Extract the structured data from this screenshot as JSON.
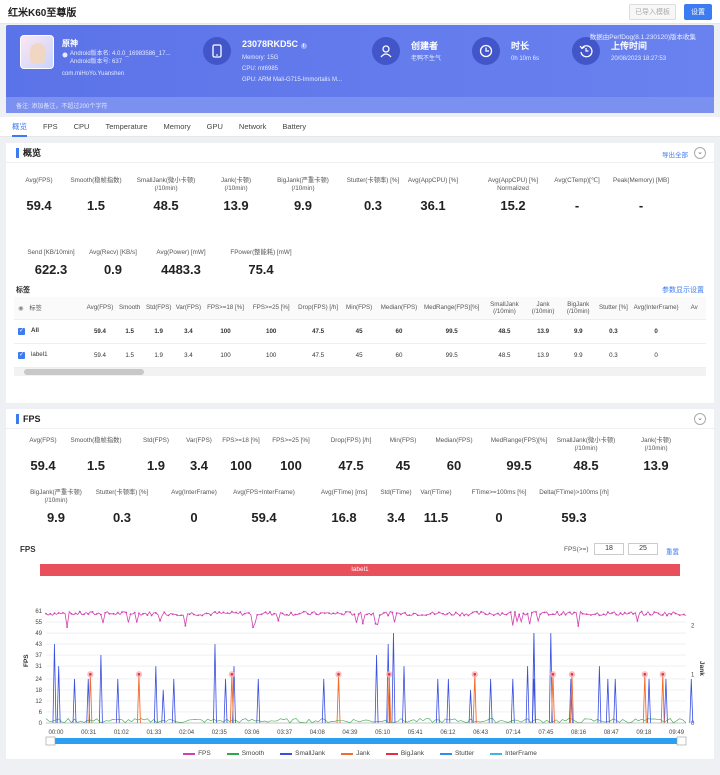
{
  "header": {
    "title": "红米K60至尊版",
    "btn_secondary": "已导入模板",
    "btn_settings": "设置"
  },
  "banner": {
    "app_name": "原神",
    "android_ver": "Android版本名: 4.0.0_16983586_17...",
    "android_code": "Android版本号: 637",
    "package": "com.miHoYo.Yuanshen",
    "device": "23078RKD5C",
    "memory": "Memory: 15G",
    "cpu": "CPU: mt6985",
    "gpu": "GPU: ARM Mali-G715-Immortalis M...",
    "creator_label": "创建者",
    "creator": "老鸭不生气",
    "duration_label": "时长",
    "duration": "0h 10m 6s",
    "upload_label": "上传时间",
    "upload": "20/08/2023 18:27:53",
    "notice": "数据由PerfDog(8.1.230120)版本收集",
    "note": "备注: 添加备注，不超过200个字符"
  },
  "tabs": [
    "概览",
    "FPS",
    "CPU",
    "Temperature",
    "Memory",
    "GPU",
    "Network",
    "Battery"
  ],
  "overview": {
    "title": "概览",
    "export": "导出全部",
    "metrics_row1": [
      {
        "label": "Avg(FPS)",
        "value": "59.4"
      },
      {
        "label": "Smooth(稳帧指数)",
        "value": "1.5"
      },
      {
        "label": "SmallJank(微小卡顿)\n(/10min)",
        "value": "48.5"
      },
      {
        "label": "Jank(卡顿)\n(/10min)",
        "value": "13.9"
      },
      {
        "label": "BigJank(严重卡顿)\n(/10min)",
        "value": "9.9"
      },
      {
        "label": "Stutter(卡顿率) [%]",
        "value": "0.3"
      },
      {
        "label": "Avg(AppCPU) [%]",
        "value": "36.1"
      },
      {
        "label": "Avg(AppCPU) [%]\nNormalized",
        "value": "15.2"
      },
      {
        "label": "Avg(CTemp)[℃]",
        "value": "-"
      },
      {
        "label": "Peak(Memory) [MB]",
        "value": "-"
      }
    ],
    "metrics_row2": [
      {
        "label": "Send [KB/10min]",
        "value": "622.3"
      },
      {
        "label": "Avg(Recv) [KB/s]",
        "value": "0.9"
      },
      {
        "label": "Avg(Power) [mW]",
        "value": "4483.3"
      },
      {
        "label": "FPower(整能耗) [mW]",
        "value": "75.4"
      }
    ],
    "tags_title": "标签",
    "tags_link": "参数显示设置",
    "table_headers": [
      "标签",
      "Avg(FPS)",
      "Smooth",
      "Std(FPS)",
      "Var(FPS)",
      "FPS>=18 [%]",
      "FPS>=25 [%]",
      "Drop(FPS) [/h]",
      "Min(FPS)",
      "Median(FPS)",
      "MedRange(FPS)[%]",
      "SmallJank\n(/10min)",
      "Jank\n(/10min)",
      "BigJank\n(/10min)",
      "Stutter [%]",
      "Avg(InterFrame)",
      "Av"
    ],
    "table_rows": [
      [
        "All",
        "59.4",
        "1.5",
        "1.9",
        "3.4",
        "100",
        "100",
        "47.5",
        "45",
        "60",
        "99.5",
        "48.5",
        "13.9",
        "9.9",
        "0.3",
        "0",
        ""
      ],
      [
        "label1",
        "59.4",
        "1.5",
        "1.9",
        "3.4",
        "100",
        "100",
        "47.5",
        "45",
        "60",
        "99.5",
        "48.5",
        "13.9",
        "9.9",
        "0.3",
        "0",
        ""
      ]
    ]
  },
  "fps_panel": {
    "title": "FPS",
    "metrics_row1": [
      {
        "label": "Avg(FPS)",
        "value": "59.4"
      },
      {
        "label": "Smooth(稳帧指数)",
        "value": "1.5"
      },
      {
        "label": "Std(FPS)",
        "value": "1.9"
      },
      {
        "label": "Var(FPS)",
        "value": "3.4"
      },
      {
        "label": "FPS>=18 [%]",
        "value": "100"
      },
      {
        "label": "FPS>=25 [%]",
        "value": "100"
      },
      {
        "label": "Drop(FPS) [/h]",
        "value": "47.5"
      },
      {
        "label": "Min(FPS)",
        "value": "45"
      },
      {
        "label": "Median(FPS)",
        "value": "60"
      },
      {
        "label": "MedRange(FPS)[%]",
        "value": "99.5"
      },
      {
        "label": "SmallJank(微小卡顿)\n(/10min)",
        "value": "48.5"
      },
      {
        "label": "Jank(卡顿)\n(/10min)",
        "value": "13.9"
      }
    ],
    "metrics_row2": [
      {
        "label": "BigJank(严重卡顿)\n(/10min)",
        "value": "9.9"
      },
      {
        "label": "Stutter(卡顿率) [%]",
        "value": "0.3"
      },
      {
        "label": "Avg(InterFrame)",
        "value": "0"
      },
      {
        "label": "Avg(FPS+InterFrame)",
        "value": "59.4"
      },
      {
        "label": "Avg(FTime) [ms]",
        "value": "16.8"
      },
      {
        "label": "Std(FTime)",
        "value": "3.4"
      },
      {
        "label": "Var(FTime)",
        "value": "11.5"
      },
      {
        "label": "FTime>=100ms [%]",
        "value": "0"
      },
      {
        "label": "Delta(FTime)>100ms [/h]",
        "value": "59.3"
      }
    ],
    "chart_label": "FPS",
    "threshold_label": "FPS(>=)",
    "threshold1": "18",
    "threshold2": "25",
    "reset": "重置",
    "label_bar": "label1"
  },
  "chart_data": {
    "type": "line",
    "title": "",
    "ylabel": "FPS",
    "y2label": "Jank",
    "yticks": [
      0,
      6,
      12,
      18,
      24,
      31,
      37,
      43,
      49,
      55,
      61
    ],
    "y2ticks": [
      0,
      1,
      2
    ],
    "ylim": [
      0,
      61
    ],
    "y2lim": [
      0,
      2.3
    ],
    "xticks": [
      "00:00",
      "00:31",
      "01:02",
      "01:33",
      "02:04",
      "02:35",
      "03:06",
      "03:37",
      "04:08",
      "04:39",
      "05:10",
      "05:41",
      "06:12",
      "06:43",
      "07:14",
      "07:45",
      "08:16",
      "08:47",
      "09:18",
      "09:49"
    ],
    "series": [
      {
        "name": "FPS",
        "color": "#d43fb0",
        "approx_value": 59.4
      },
      {
        "name": "Smooth",
        "color": "#2ea84a"
      },
      {
        "name": "SmallJank",
        "color": "#3a4fe0",
        "spike_times_s": [
          8,
          12,
          27,
          40,
          52,
          68,
          104,
          111,
          121,
          160,
          170,
          178,
          201,
          263,
          313,
          324,
          329,
          339,
          371,
          381,
          402,
          421,
          442,
          456,
          462,
          478,
          497,
          524,
          532,
          539,
          571,
          587,
          611
        ]
      },
      {
        "name": "Jank",
        "color": "#f26d2c",
        "spike_times_s": [
          42,
          88,
          176,
          277,
          325,
          406,
          480,
          498,
          567,
          584
        ]
      },
      {
        "name": "BigJank",
        "color": "#e23040",
        "spike_times_s": [
          42,
          88,
          176,
          277,
          325,
          406,
          480,
          498,
          567,
          584
        ]
      },
      {
        "name": "Stutter",
        "color": "#2d8ff0"
      },
      {
        "name": "InterFrame",
        "color": "#3fb7d8"
      }
    ],
    "duration_s": 606
  },
  "colors": {
    "accent": "#3d7bf0",
    "banner": "#5b73e8"
  },
  "icons": [
    "phone-icon",
    "user-icon",
    "clock-icon",
    "history-icon",
    "info-icon",
    "help-icon",
    "chevron-down-icon"
  ]
}
